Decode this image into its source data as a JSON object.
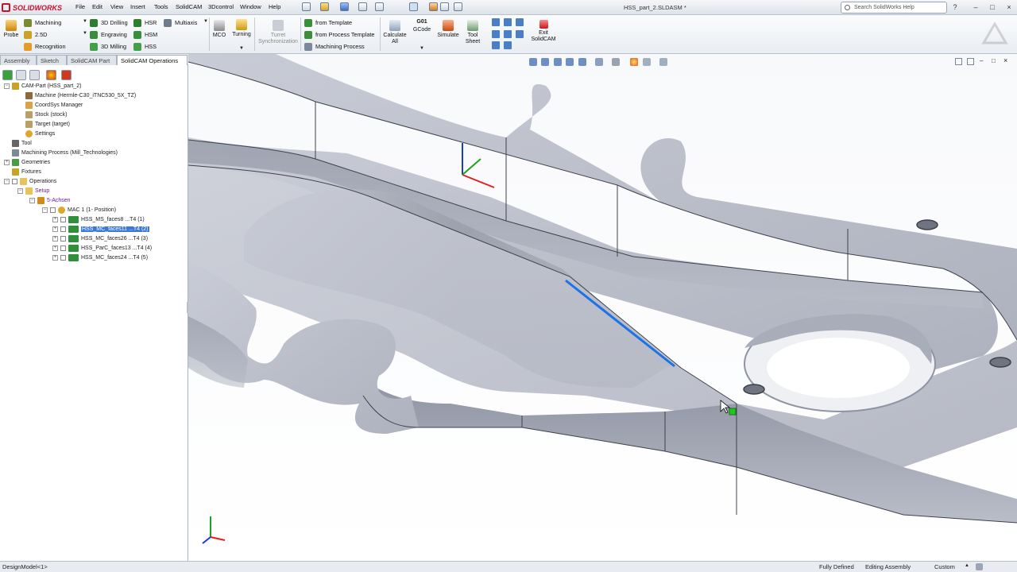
{
  "app": {
    "brand": "SOLIDWORKS",
    "document_title": "HSS_part_2.SLDASM *"
  },
  "menu": [
    "File",
    "Edit",
    "View",
    "Insert",
    "Tools",
    "SolidCAM",
    "3Dcontrol",
    "Window",
    "Help"
  ],
  "search": {
    "placeholder": "Search SolidWorks Help"
  },
  "command_manager": {
    "probe": "Probe",
    "machining": "Machining",
    "d25": "2.5D",
    "recognition": "Recognition",
    "drilling3d": "3D Drilling",
    "engraving": "Engraving",
    "milling3d": "3D Milling",
    "hsr": "HSR",
    "hsm": "HSM",
    "hss": "HSS",
    "multiaxis": "Multiaxis",
    "mco": "MCO",
    "turning": "Turning",
    "turret_sync": "Turret Synchronization",
    "from_template": "from Template",
    "from_process_template": "from Process Template",
    "machining_process": "Machining Process",
    "calculate_all": "Calculate All",
    "gcode_top": "G01",
    "gcode": "GCode",
    "simulate": "Simulate",
    "tool_sheet": "Tool Sheet",
    "exit_solidcam": "Exit SolidCAM"
  },
  "tabs": [
    "Assembly",
    "Sketch",
    "SolidCAM Part",
    "SolidCAM Operations"
  ],
  "tree": [
    {
      "label": "CAM-Part (HSS_part_2)",
      "indent": 0
    },
    {
      "label": "Machine (Hermle-C30_iTNC530_5X_TZ)",
      "indent": 1
    },
    {
      "label": "CoordSys Manager",
      "indent": 1
    },
    {
      "label": "Stock (stock)",
      "indent": 1
    },
    {
      "label": "Target (target)",
      "indent": 1
    },
    {
      "label": "Settings",
      "indent": 1
    },
    {
      "label": "Tool",
      "indent": 0
    },
    {
      "label": "Machining Process (Mill_Technologies)",
      "indent": 0
    },
    {
      "label": "Geometries",
      "indent": 0
    },
    {
      "label": "Fixtures",
      "indent": 0
    },
    {
      "label": "Operations",
      "indent": 0
    },
    {
      "label": "Setup",
      "indent": 1
    },
    {
      "label": "5-Achsen",
      "indent": 2
    },
    {
      "label": "MAC 1 (1- Position)",
      "indent": 3
    },
    {
      "label": "HSS_MS_faces8 ...T4 (1)",
      "indent": 4
    },
    {
      "label": "HSS_MC_faces11 ...T4 (2)",
      "indent": 4
    },
    {
      "label": "HSS_MC_faces26 ...T4 (3)",
      "indent": 4
    },
    {
      "label": "HSS_ParC_faces13 ...T4 (4)",
      "indent": 4
    },
    {
      "label": "HSS_MC_faces24 ...T4 (5)",
      "indent": 4
    }
  ],
  "status": {
    "left": "DesignModel<1>",
    "defined": "Fully Defined",
    "editing": "Editing Assembly",
    "units": "Custom"
  },
  "colors": {
    "accent": "#3a79d6",
    "brand": "#c8102e",
    "part": "#b4b8c4"
  }
}
